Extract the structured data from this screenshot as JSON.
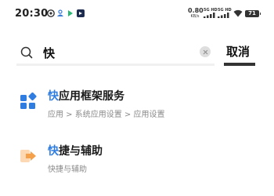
{
  "status_bar": {
    "time": "20:30",
    "net_speed": "0.80",
    "net_unit": "KB/s",
    "sim1_label": "5G HD",
    "sim2_label": "5G HD",
    "battery": "71",
    "icons": [
      "shield-icon",
      "cloud-icon",
      "arrow-icon",
      "app-badge-icon",
      "wifi-icon",
      "battery-icon"
    ]
  },
  "search": {
    "query": "快",
    "cancel_label": "取消"
  },
  "results": [
    {
      "highlight": "快",
      "rest": "应用框架服务",
      "path": "应用 > 系统应用设置 > 应用设置",
      "icon": "app-framework-icon",
      "color": "#2f7de1"
    },
    {
      "highlight": "快",
      "rest": "捷与辅助",
      "path": "快捷与辅助",
      "icon": "shortcut-assist-icon",
      "color": "#f5a04a"
    }
  ],
  "colors": {
    "highlight": "#2f7de1",
    "accent_orange": "#f5a04a"
  }
}
